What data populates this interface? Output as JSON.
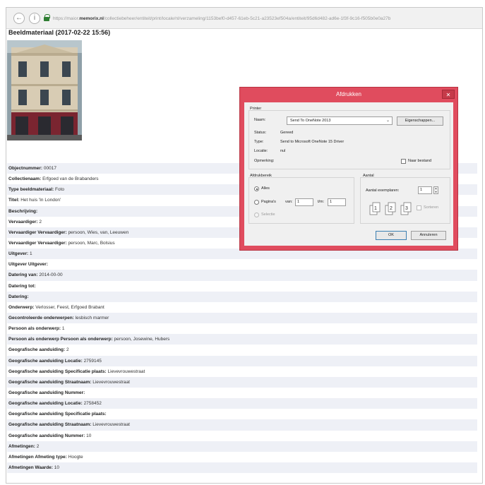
{
  "browser": {
    "url_prefix": "https://maior.",
    "url_domain": "memorix.nl",
    "url_suffix": "/collectiebeheer/entiteit/print/locale/nl/verzameling/1153bef0-d457-61eb-5c21-a23523ef504a/entiteit/95d6d482-ad6e-1f3f-9c16-f505b0e0a27b"
  },
  "page": {
    "title": "Beeldmateriaal (2017-02-22 15:56)"
  },
  "rows": [
    {
      "label": "Objectnummer:",
      "value": "00017"
    },
    {
      "label": "Collectienaam:",
      "value": "Erfgoed van de Brabanders"
    },
    {
      "label": "Type beeldmateriaal:",
      "value": "Foto"
    },
    {
      "label": "Titel:",
      "value": "Het huis 'In London'"
    },
    {
      "label": "Beschrijving:",
      "value": ""
    },
    {
      "label": "Vervaardiger:",
      "value": "2"
    },
    {
      "label": "Vervaardiger Vervaardiger:",
      "value": "persoon, Wies, van, Leeuwen"
    },
    {
      "label": "Vervaardiger Vervaardiger:",
      "value": "persoon, Marc, Bolsius"
    },
    {
      "label": "Uitgever:",
      "value": "1"
    },
    {
      "label": "Uitgever Uitgever:",
      "value": ""
    },
    {
      "label": "Datering van:",
      "value": "2014-00-00"
    },
    {
      "label": "Datering tot:",
      "value": ""
    },
    {
      "label": "Datering:",
      "value": ""
    },
    {
      "label": "Onderwerp:",
      "value": "Verlosser, Feest, Erfgoed Brabant"
    },
    {
      "label": "Gecontroleerde onderwerpen:",
      "value": "lesbisch marmer"
    },
    {
      "label": "Persoon als onderwerp:",
      "value": "1"
    },
    {
      "label": "Persoon als onderwerp Persoon als onderwerp:",
      "value": "persoon, Josewine, Hubers"
    },
    {
      "label": "Geografische aanduiding:",
      "value": "2"
    },
    {
      "label": "Geografische aanduiding Locatie:",
      "value": "2759145"
    },
    {
      "label": "Geografische aanduiding Specificatie plaats:",
      "value": "Lievevrouwestraat"
    },
    {
      "label": "Geografische aanduiding Straatnaam:",
      "value": "Lievevrouwestraat"
    },
    {
      "label": "Geografische aanduiding Nummer:",
      "value": ""
    },
    {
      "label": "Geografische aanduiding Locatie:",
      "value": "2758452"
    },
    {
      "label": "Geografische aanduiding Specificatie plaats:",
      "value": ""
    },
    {
      "label": "Geografische aanduiding Straatnaam:",
      "value": "Lievevrouwestraat"
    },
    {
      "label": "Geografische aanduiding Nummer:",
      "value": "10"
    },
    {
      "label": "Afmetingen:",
      "value": "2"
    },
    {
      "label": "Afmetingen Afmeting type:",
      "value": "Hoogte"
    },
    {
      "label": "Afmetingen Waarde:",
      "value": "10"
    }
  ],
  "dialog": {
    "title": "Afdrukken",
    "close": "✕",
    "printer_group": "Printer",
    "name_label": "Naam:",
    "printer_name": "Send To OneNote 2013",
    "properties_button": "Eigenschappen...",
    "status_label": "Status:",
    "status_value": "Gereed",
    "type_label": "Type:",
    "type_value": "Send to Microsoft OneNote 15 Driver",
    "location_label": "Locatie:",
    "location_value": "nul",
    "comment_label": "Opmerking:",
    "print_to_file": "Naar bestand",
    "range_group": "Afdrukbereik",
    "range_all": "Alles",
    "range_pages": "Pagina's",
    "from_label": "van:",
    "from_value": "1",
    "to_label": "t/m:",
    "to_value": "1",
    "range_selection": "Selectie",
    "copies_group": "Aantal",
    "copies_label": "Aantal exemplaren:",
    "copies_value": "1",
    "collate": "Sorteren",
    "ok_button": "OK",
    "cancel_button": "Annuleren"
  },
  "colors": {
    "dialog_frame": "#e04c5e",
    "row_stripe": "#eef0f6",
    "lock": "#2e7d32"
  }
}
